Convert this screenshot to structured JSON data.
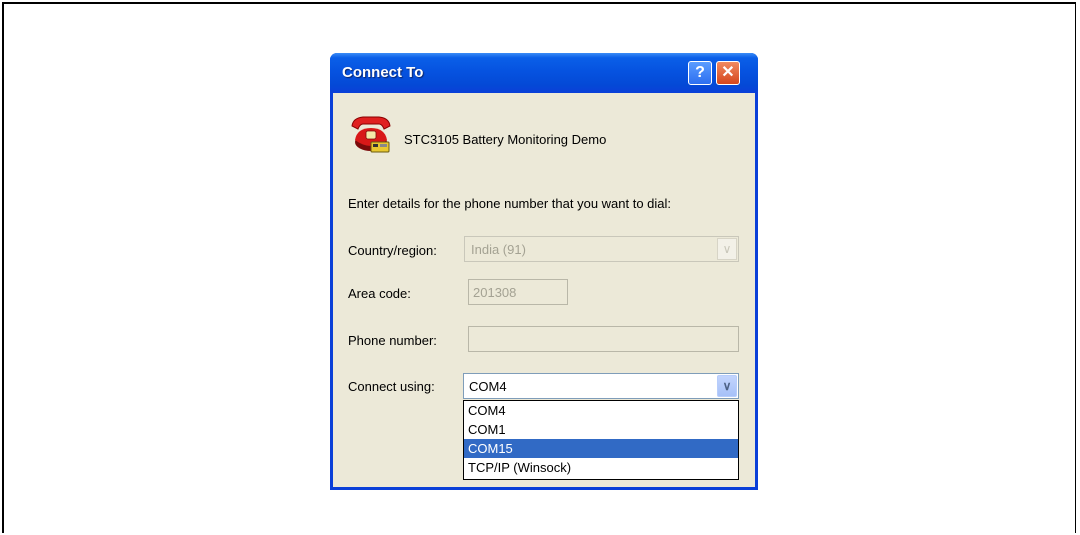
{
  "window": {
    "title": "Connect To",
    "help_glyph": "?",
    "close_glyph": "✕"
  },
  "connection": {
    "icon": "phone-icon",
    "name": "STC3105 Battery Monitoring Demo"
  },
  "form": {
    "prompt": "Enter details for the phone number that you want to dial:",
    "country_label": "Country/region:",
    "country_value": "India (91)",
    "area_code_label": "Area code:",
    "area_code_value": "201308",
    "phone_label": "Phone number:",
    "phone_value": "",
    "connect_using_label": "Connect using:",
    "connect_using_value": "COM4"
  },
  "dropdown": {
    "options": [
      "COM4",
      "COM1",
      "COM15",
      "TCP/IP (Winsock)"
    ],
    "highlighted": "COM15"
  },
  "colors": {
    "titlebar": "#0a5fe8",
    "selection": "#316ac5",
    "dialog_bg": "#ece9d8"
  }
}
